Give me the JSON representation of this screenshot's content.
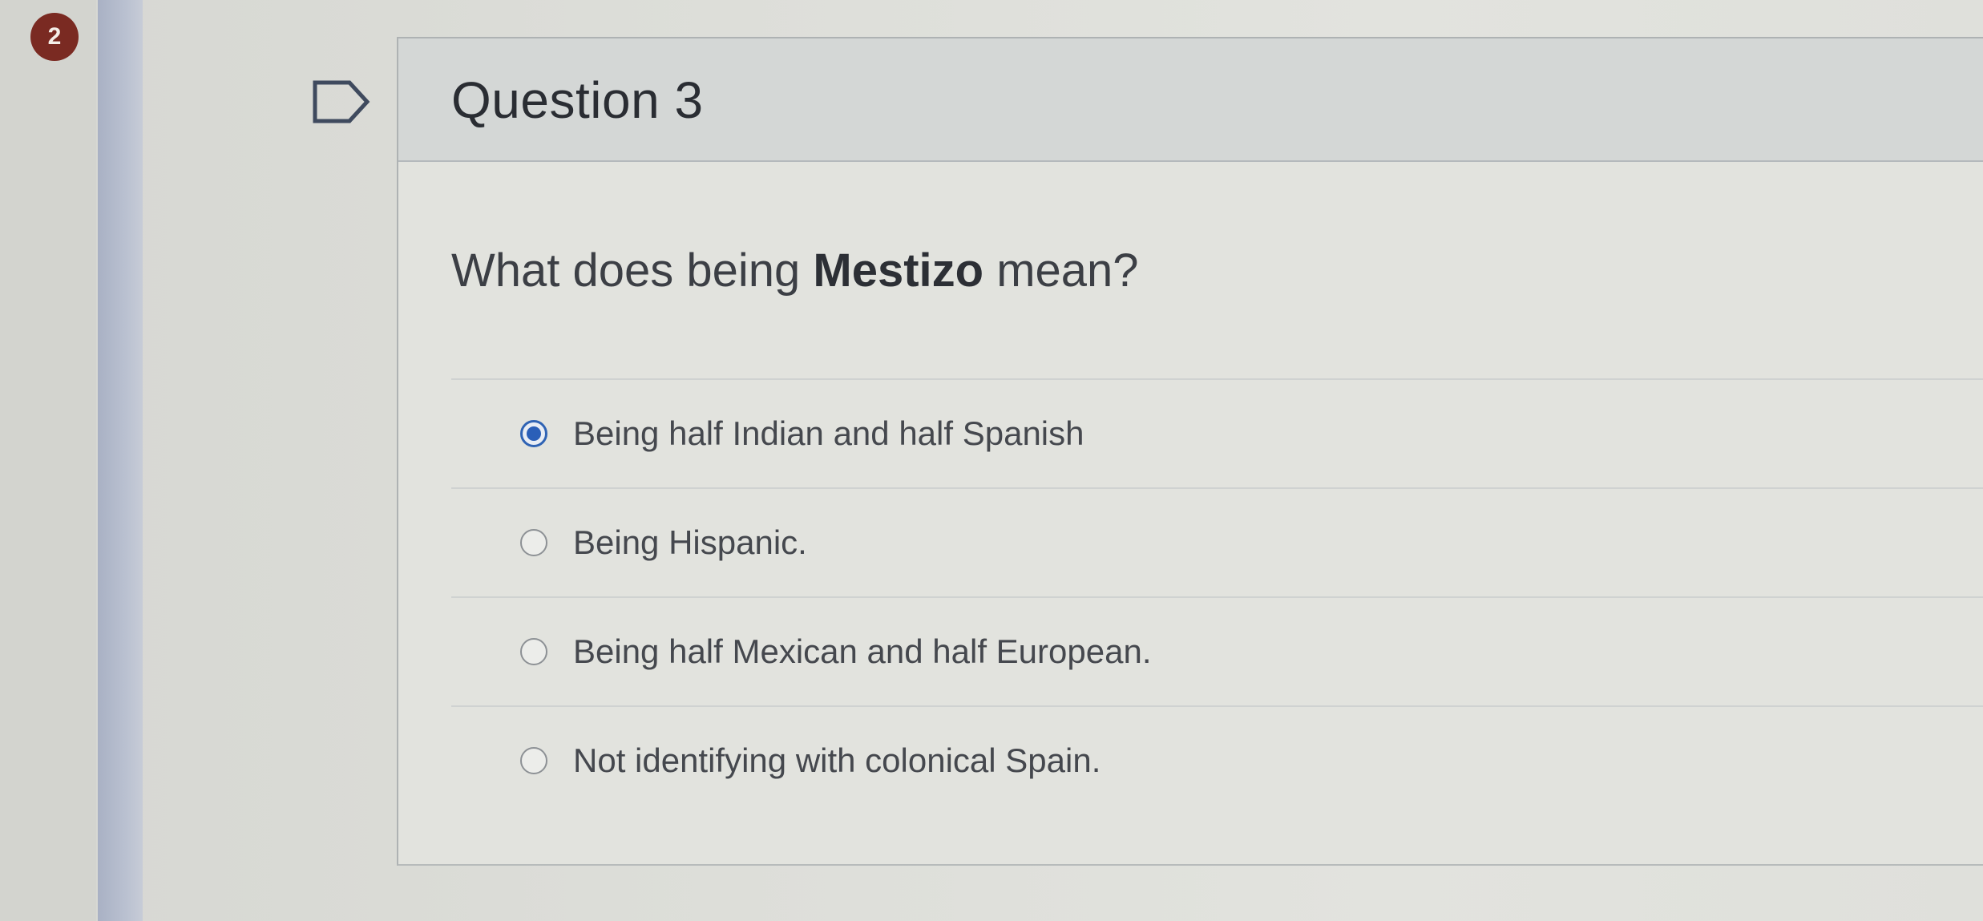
{
  "notification": {
    "count": "2"
  },
  "question": {
    "title": "Question 3",
    "prompt_before": "What does being ",
    "prompt_bold": "Mestizo",
    "prompt_after": " mean?"
  },
  "answers": [
    {
      "label": "Being half Indian and half Spanish",
      "selected": true
    },
    {
      "label": "Being Hispanic.",
      "selected": false
    },
    {
      "label": "Being half Mexican and half European.",
      "selected": false
    },
    {
      "label": "Not identifying with colonical Spain.",
      "selected": false
    }
  ],
  "colors": {
    "accent": "#2a5fb8",
    "badge": "#7a2a22",
    "nav": "#b9c0d0"
  }
}
